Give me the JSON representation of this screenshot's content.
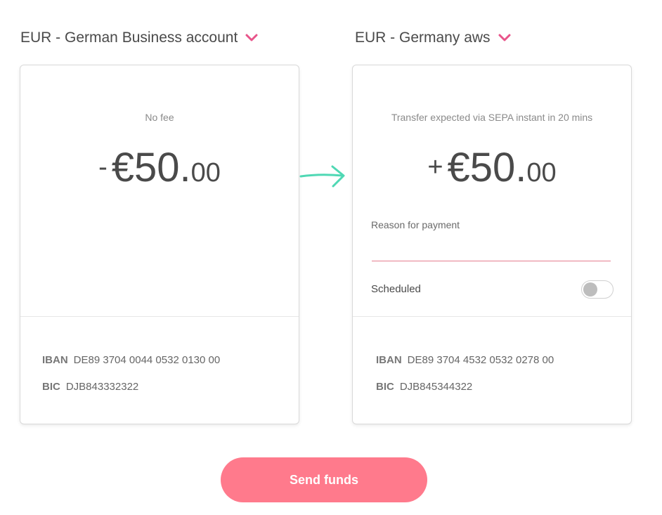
{
  "from": {
    "account_label": "EUR - German Business account",
    "note": "No fee",
    "sign": "-",
    "amount_main": "€50.",
    "amount_cents": "00",
    "iban_label": "IBAN",
    "iban": "DE89 3704 0044 0532 0130 00",
    "bic_label": "BIC",
    "bic": "DJB843332322"
  },
  "to": {
    "account_label": "EUR - Germany aws",
    "note": "Transfer expected via SEPA instant in 20 mins",
    "sign": "+",
    "amount_main": "€50.",
    "amount_cents": "00",
    "reason_label": "Reason for payment",
    "reason_value": "",
    "scheduled_label": "Scheduled",
    "scheduled_on": false,
    "iban_label": "IBAN",
    "iban": "DE89 3704 4532 0532 0278 00",
    "bic_label": "BIC",
    "bic": "DJB845344322"
  },
  "icons": {
    "dropdown": "chevron-down-icon",
    "transfer": "arrow-right-icon"
  },
  "colors": {
    "accent": "#ff7a8c",
    "chevron": "#e8548a",
    "arrow": "#4fd8b4",
    "input_underline": "#e57d8f"
  },
  "send_button_label": "Send funds"
}
